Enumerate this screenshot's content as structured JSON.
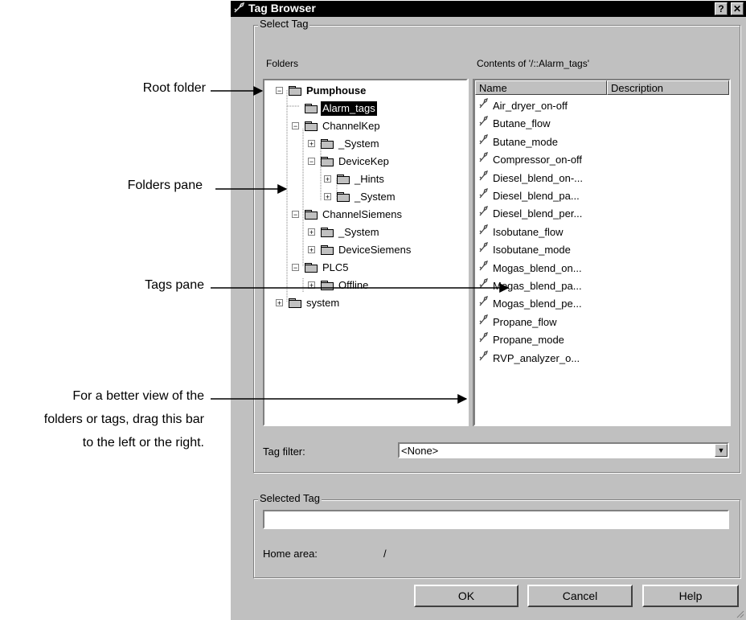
{
  "annotations": {
    "root_folder": "Root folder",
    "folders_pane": "Folders pane",
    "tags_pane": "Tags pane",
    "drag_bar_line1": "For a better view of the",
    "drag_bar_line2": "folders or tags, drag this bar",
    "drag_bar_line3": "to the left or the right."
  },
  "window": {
    "title": "Tag Browser",
    "title_icon": "tag-icon",
    "help_button": "?",
    "close_button": "✕"
  },
  "select_tag_group": {
    "label": "Select Tag"
  },
  "folders_pane": {
    "header": "Folders",
    "tree": [
      {
        "label": "Pumphouse",
        "expander": "⊟",
        "icon": "computer-icon"
      },
      {
        "label": "Alarm_tags",
        "expander": "",
        "icon": "folder-open-icon"
      },
      {
        "label": "ChannelKep",
        "expander": "⊟",
        "icon": "folder-icon"
      },
      {
        "label": "_System",
        "expander": "⊞",
        "icon": "folder-icon"
      },
      {
        "label": "DeviceKep",
        "expander": "⊟",
        "icon": "folder-icon"
      },
      {
        "label": "_Hints",
        "expander": "⊞",
        "icon": "folder-icon"
      },
      {
        "label": "_System",
        "expander": "⊞",
        "icon": "folder-icon"
      },
      {
        "label": "ChannelSiemens",
        "expander": "⊟",
        "icon": "folder-icon"
      },
      {
        "label": "_System",
        "expander": "⊞",
        "icon": "folder-icon"
      },
      {
        "label": "DeviceSiemens",
        "expander": "⊞",
        "icon": "folder-icon"
      },
      {
        "label": "PLC5",
        "expander": "⊟",
        "icon": "folder-icon"
      },
      {
        "label": "Offline",
        "expander": "⊞",
        "icon": "folder-icon"
      },
      {
        "label": "system",
        "expander": "⊞",
        "icon": "folder-icon"
      }
    ]
  },
  "tags_pane": {
    "header": "Contents of '/::Alarm_tags'",
    "columns": [
      "Name",
      "Description"
    ],
    "tag_icon": "tag-icon",
    "tags": [
      "Air_dryer_on-off",
      "Butane_flow",
      "Butane_mode",
      "Compressor_on-off",
      "Diesel_blend_on-...",
      "Diesel_blend_pa...",
      "Diesel_blend_per...",
      "Isobutane_flow",
      "Isobutane_mode",
      "Mogas_blend_on...",
      "Mogas_blend_pa...",
      "Mogas_blend_pe...",
      "Propane_flow",
      "Propane_mode",
      "RVP_analyzer_o..."
    ]
  },
  "tag_filter": {
    "label": "Tag filter:",
    "value": "<None>"
  },
  "selected_tag_group": {
    "label": "Selected Tag",
    "value": "",
    "home_area_label": "Home area:",
    "home_area_value": "/"
  },
  "buttons": {
    "ok": "OK",
    "cancel": "Cancel",
    "help": "Help"
  }
}
